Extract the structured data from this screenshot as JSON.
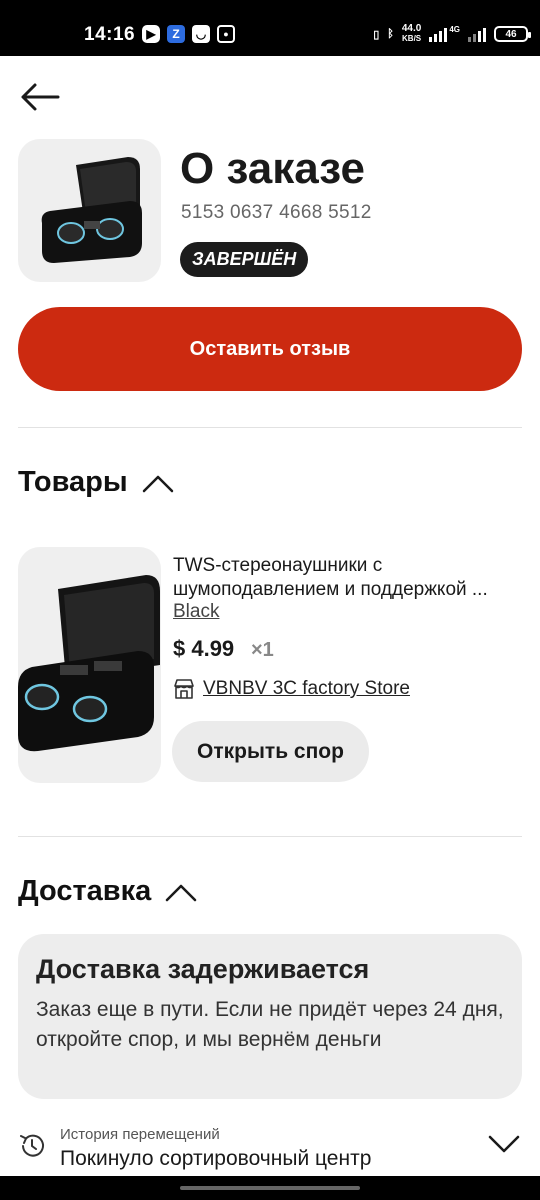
{
  "status_bar": {
    "time": "14:16",
    "app_icons": [
      "youtube-icon",
      "zen-icon",
      "messenger-icon",
      "instagram-icon"
    ],
    "net_speed_value": "44.0",
    "net_speed_unit": "KB/S",
    "network_type": "4G",
    "battery_level": "46"
  },
  "order": {
    "title": "О заказе",
    "number": "5153 0637 4668 5512",
    "status": "ЗАВЕРШЁН"
  },
  "review_button": {
    "label": "Оставить отзыв",
    "color": "#cc2a10"
  },
  "products_section": {
    "title": "Товары",
    "items": [
      {
        "name": "TWS-стереонаушники с шумоподавлением и поддержкой ...",
        "variant": "Black",
        "price": "$ 4.99",
        "quantity": "×1",
        "store": "VBNBV 3C factory Store",
        "dispute_label": "Открыть спор"
      }
    ]
  },
  "delivery_section": {
    "title": "Доставка",
    "notice_title": "Доставка задерживается",
    "notice_text": "Заказ еще в пути. Если не придёт через 24 дня, откройте спор, и мы вернём деньги",
    "history_label": "История перемещений",
    "history_value": "Покинуло сортировочный центр"
  }
}
